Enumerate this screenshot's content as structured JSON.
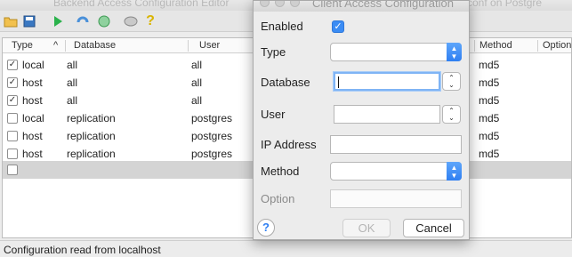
{
  "window": {
    "title": "Backend Access Configuration Editor",
    "title_right": "conf on Postgre"
  },
  "toolbar": {
    "icons": [
      "open-folder-icon",
      "save-icon",
      "run-icon",
      "undo-icon",
      "recycle-icon",
      "badge-icon",
      "help-icon"
    ]
  },
  "table": {
    "headers": {
      "type": "Type",
      "database": "Database",
      "user": "User",
      "method": "Method",
      "option": "Option"
    },
    "rows": [
      {
        "checked": true,
        "type": "local",
        "database": "all",
        "user": "all",
        "method": "md5"
      },
      {
        "checked": true,
        "type": "host",
        "database": "all",
        "user": "all",
        "method": "md5"
      },
      {
        "checked": true,
        "type": "host",
        "database": "all",
        "user": "all",
        "method": "md5"
      },
      {
        "checked": false,
        "type": "local",
        "database": "replication",
        "user": "postgres",
        "method": "md5"
      },
      {
        "checked": false,
        "type": "host",
        "database": "replication",
        "user": "postgres",
        "method": "md5"
      },
      {
        "checked": false,
        "type": "host",
        "database": "replication",
        "user": "postgres",
        "method": "md5"
      }
    ],
    "check_mark": "✓",
    "sort_indicator": "^"
  },
  "status": {
    "text": "Configuration read from localhost"
  },
  "dialog": {
    "title": "Client Access Configuration",
    "enabled_label": "Enabled",
    "enabled": true,
    "type_label": "Type",
    "database_label": "Database",
    "user_label": "User",
    "ip_label": "IP Address",
    "method_label": "Method",
    "option_label": "Option",
    "type_value": "",
    "database_value": "",
    "user_value": "",
    "ip_value": "",
    "method_value": "",
    "option_value": "",
    "ok_label": "OK",
    "cancel_label": "Cancel",
    "help_label": "?"
  },
  "colors": {
    "accent": "#3b8cf4",
    "selection": "#d4d4d4"
  }
}
